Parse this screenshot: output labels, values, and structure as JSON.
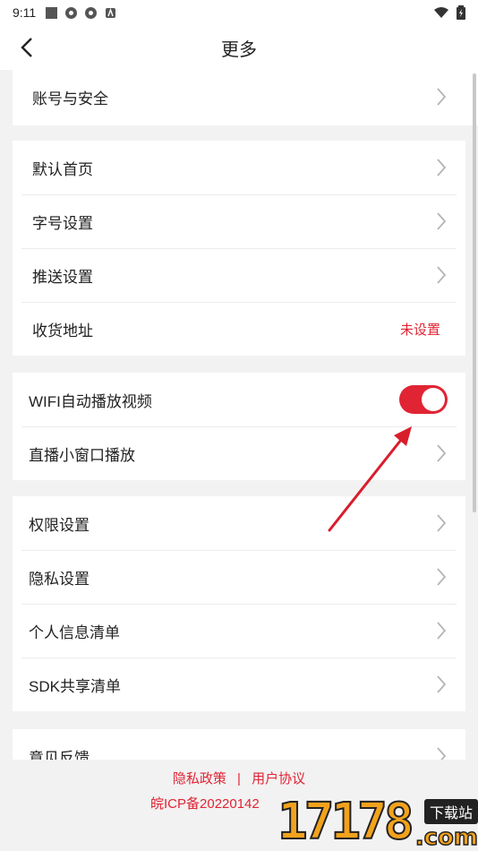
{
  "status": {
    "time": "9:11"
  },
  "header": {
    "title": "更多"
  },
  "groups": {
    "g0": [
      {
        "label": "账号与安全"
      }
    ],
    "g1": [
      {
        "label": "默认首页"
      },
      {
        "label": "字号设置"
      },
      {
        "label": "推送设置"
      },
      {
        "label": "收货地址",
        "value": "未设置"
      }
    ],
    "g2": [
      {
        "label": "WIFI自动播放视频",
        "toggle_on": true
      },
      {
        "label": "直播小窗口播放"
      }
    ],
    "g3": [
      {
        "label": "权限设置"
      },
      {
        "label": "隐私设置"
      },
      {
        "label": "个人信息清单"
      },
      {
        "label": "SDK共享清单"
      }
    ],
    "g4": [
      {
        "label": "意见反馈"
      }
    ]
  },
  "footer": {
    "privacy_label": "隐私政策",
    "separator": "|",
    "agreement_label": "用户协议",
    "icp": "皖ICP备20220142"
  },
  "watermark": {
    "digits": "17178",
    "badge": "下载站",
    "suffix": ".com"
  },
  "colors": {
    "accent": "#e02434",
    "background": "#f2f2f2",
    "divider": "#ececec"
  }
}
